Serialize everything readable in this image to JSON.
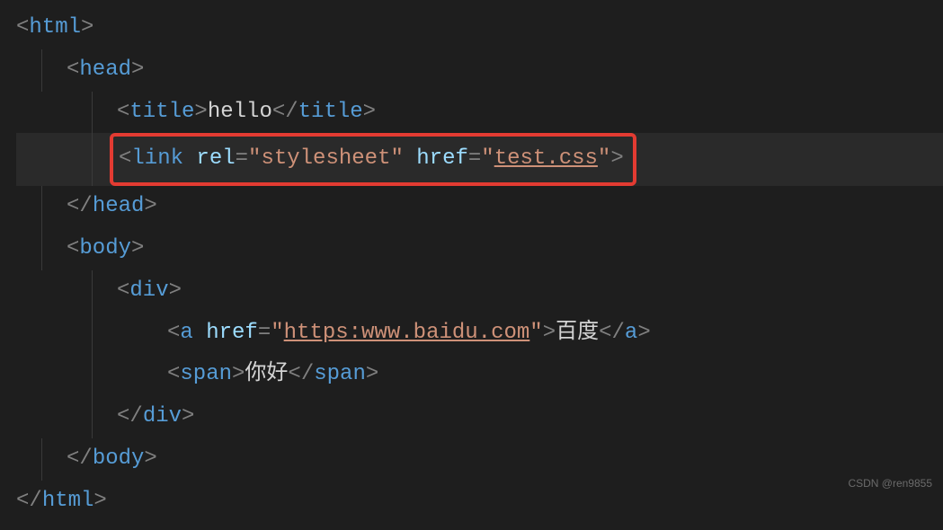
{
  "tags": {
    "html_open": "html",
    "html_close": "html",
    "head_open": "head",
    "head_close": "head",
    "title_open": "title",
    "title_close": "title",
    "link": "link",
    "body_open": "body",
    "body_close": "body",
    "div_open": "div",
    "div_close": "div",
    "a_open": "a",
    "a_close": "a",
    "span_open": "span",
    "span_close": "span"
  },
  "attrs": {
    "rel": "rel",
    "href": "href"
  },
  "vals": {
    "title_text": "hello",
    "rel_val": "\"stylesheet\"",
    "link_href_val": "test.css",
    "a_href_val": "https:www.baidu.com",
    "a_text": "百度",
    "span_text": "你好"
  },
  "punct": {
    "lt": "<",
    "gt": ">",
    "lts": "</",
    "eq": "=",
    "q": "\""
  },
  "watermark": "CSDN @ren9855"
}
